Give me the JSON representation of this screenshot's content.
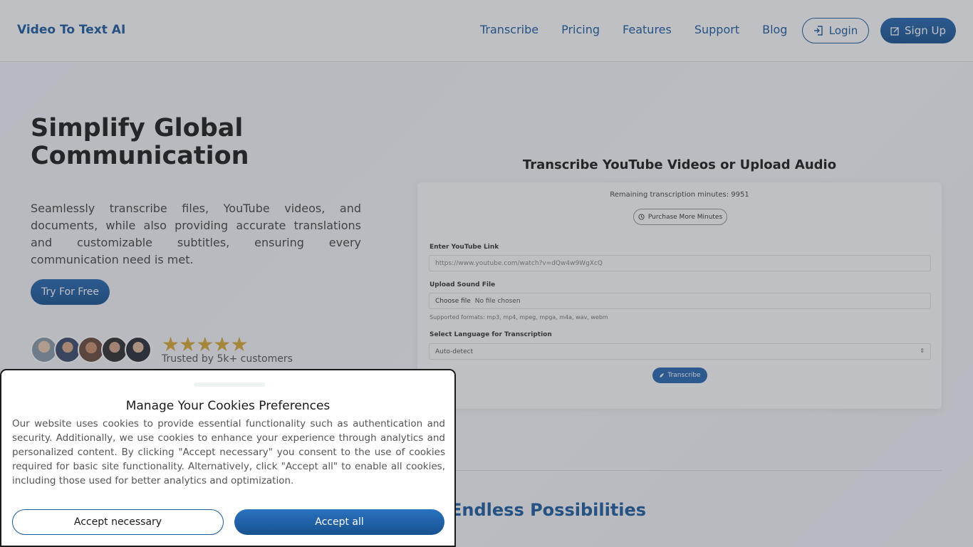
{
  "header": {
    "logo": "Video To Text AI",
    "nav": [
      "Transcribe",
      "Pricing",
      "Features",
      "Support",
      "Blog"
    ],
    "login": "Login",
    "signup": "Sign Up"
  },
  "hero": {
    "title": "Simplify Global Communication",
    "description": "Seamlessly transcribe files, YouTube videos, and documents, while also providing accurate translations and customizable subtitles, ensuring every communication need is met.",
    "cta": "Try For Free",
    "rating_stars": "★★★★★",
    "trusted": "Trusted by 5k+ customers"
  },
  "transcriber": {
    "title": "Transcribe YouTube Videos or Upload Audio",
    "remaining": "Remaining transcription minutes: 9951",
    "purchase": "Purchase More Minutes",
    "youtube_label": "Enter YouTube Link",
    "youtube_placeholder": "https://www.youtube.com/watch?v=dQw4w9WgXcQ",
    "upload_label": "Upload Sound File",
    "choose_file": "Choose file",
    "no_file": "No file chosen",
    "formats": "Supported formats: mp3, mp4, mpeg, mpga, m4a, wav, webm",
    "language_label": "Select Language for Transcription",
    "language_value": "Auto-detect",
    "transcribe_btn": "Transcribe"
  },
  "section": {
    "heading": "Endless Possibilities"
  },
  "cookie": {
    "title": "Manage Your Cookies Preferences",
    "text": "Our website uses cookies to provide essential functionality such as authentication and security. Additionally, we use cookies to enhance your experience through analytics and personalized content. By clicking \"Accept necessary\" you consent to the use of cookies required for basic site functionality. Alternatively, click \"Accept all\" to enable all cookies, including those used for better analytics and optimization.",
    "accept_necessary": "Accept necessary",
    "accept_all": "Accept all"
  },
  "colors": {
    "brand": "#1b5a9e",
    "star": "#d9a934"
  }
}
